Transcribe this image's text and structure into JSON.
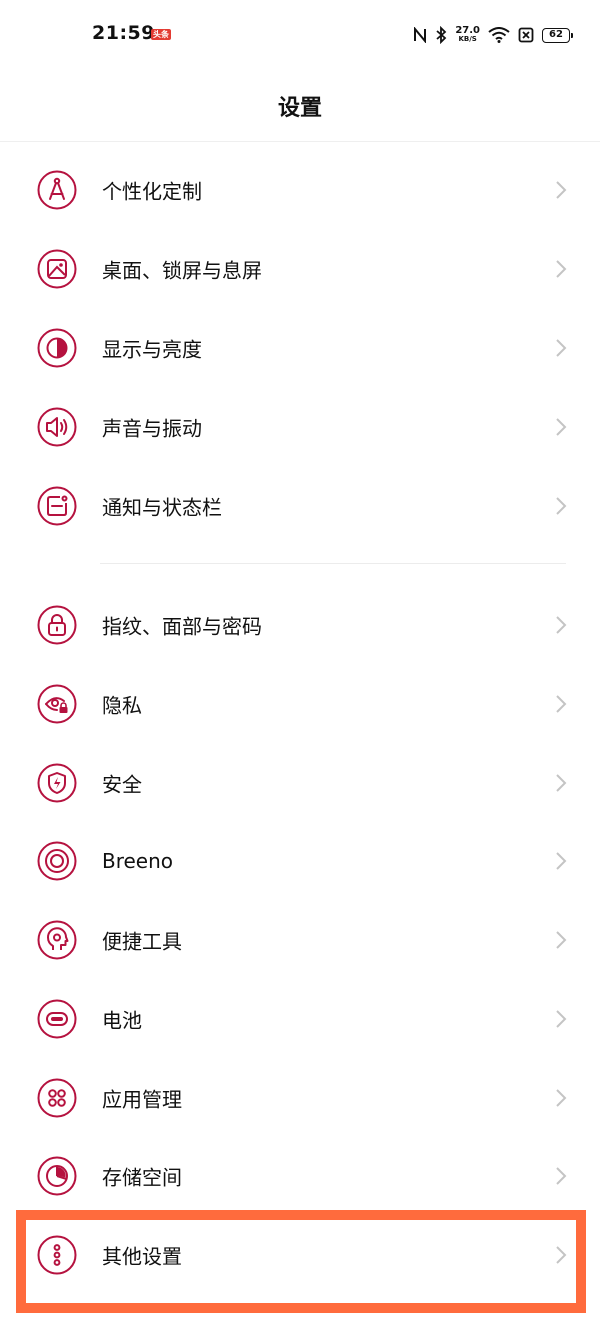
{
  "status": {
    "time": "21:59",
    "badge": "头条",
    "net_speed_value": "27.0",
    "net_speed_unit": "KB/S",
    "battery": "62"
  },
  "header": {
    "title": "设置"
  },
  "groups": [
    {
      "items": [
        {
          "label": "个性化定制",
          "icon": "compass-icon"
        },
        {
          "label": "桌面、锁屏与息屏",
          "icon": "wallpaper-icon"
        },
        {
          "label": "显示与亮度",
          "icon": "brightness-icon"
        },
        {
          "label": "声音与振动",
          "icon": "speaker-icon"
        },
        {
          "label": "通知与状态栏",
          "icon": "notification-icon"
        }
      ]
    },
    {
      "items": [
        {
          "label": "指纹、面部与密码",
          "icon": "lock-icon"
        },
        {
          "label": "隐私",
          "icon": "privacy-eye-icon"
        },
        {
          "label": "安全",
          "icon": "shield-icon"
        },
        {
          "label": "Breeno",
          "icon": "breeno-icon"
        },
        {
          "label": "便捷工具",
          "icon": "head-gear-icon"
        },
        {
          "label": "电池",
          "icon": "battery-icon"
        },
        {
          "label": "应用管理",
          "icon": "apps-grid-icon"
        },
        {
          "label": "存储空间",
          "icon": "pie-chart-icon"
        },
        {
          "label": "其他设置",
          "icon": "more-dots-icon"
        }
      ]
    }
  ],
  "colors": {
    "accent": "#b5123f",
    "highlight": "#ff6b3d"
  }
}
